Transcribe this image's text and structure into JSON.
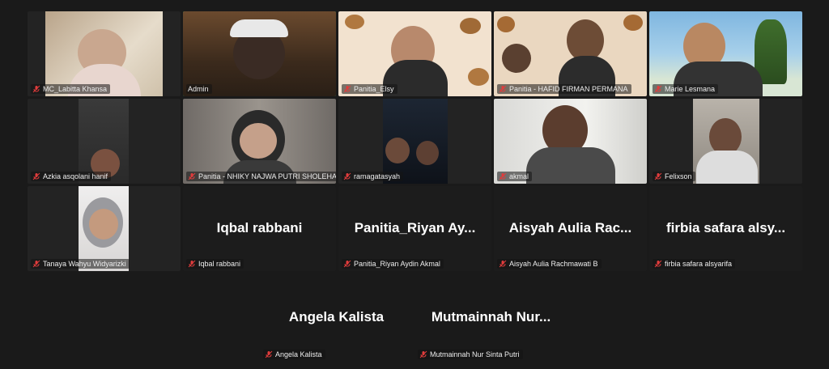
{
  "participants": [
    {
      "name": "MC_Labitta Khansa",
      "display": ""
    },
    {
      "name": "Admin",
      "display": ""
    },
    {
      "name": "Panitia_Elsy",
      "display": ""
    },
    {
      "name": "Panitia - HAFID FIRMAN PERMANA",
      "display": ""
    },
    {
      "name": "Marie Lesmana",
      "display": ""
    },
    {
      "name": "Azkia asqolani hanif",
      "display": ""
    },
    {
      "name": "Panitia - NHIKY NAJWA PUTRI SHOLEHA",
      "display": ""
    },
    {
      "name": "ramagatasyah",
      "display": ""
    },
    {
      "name": "akmal",
      "display": ""
    },
    {
      "name": "Felixson",
      "display": ""
    },
    {
      "name": "Tanaya Wahyu Widyarizki",
      "display": ""
    },
    {
      "name": "Iqbal rabbani",
      "display": "Iqbal rabbani"
    },
    {
      "name": "Panitia_Riyan Aydin Akmal",
      "display": "Panitia_Riyan Ay..."
    },
    {
      "name": "Aisyah Aulia Rachmawati B",
      "display": "Aisyah Aulia Rac..."
    },
    {
      "name": "firbia safara alsyarifa",
      "display": "firbia safara alsy..."
    },
    {
      "name": "Angela Kalista",
      "display": "Angela Kalista"
    },
    {
      "name": "Mutmainnah Nur Sinta Putri",
      "display": "Mutmainnah Nur..."
    }
  ],
  "colors": {
    "background": "#1a1a1a",
    "active_border": "#2ed37a",
    "muted_mic": "#e03c3c"
  },
  "icons": {
    "mic": "mic-muted-icon"
  }
}
